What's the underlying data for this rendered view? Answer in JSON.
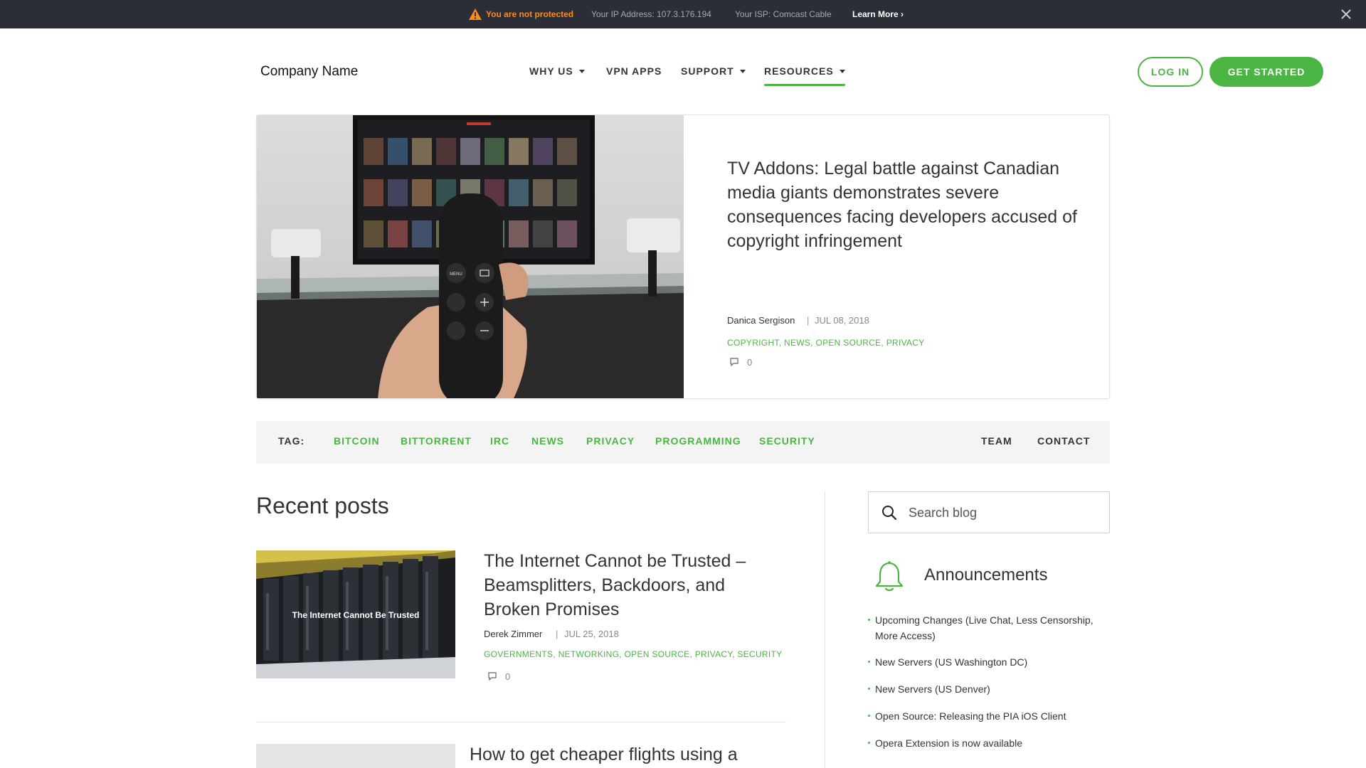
{
  "notice": {
    "warning": "You are not protected",
    "ip": "Your IP Address: 107.3.176.194",
    "isp": "Your ISP: Comcast Cable",
    "learn_more": "Learn More ›"
  },
  "header": {
    "brand": "Company Name",
    "nav": [
      {
        "label": "WHY US",
        "dropdown": true
      },
      {
        "label": "VPN APPS",
        "dropdown": false
      },
      {
        "label": "SUPPORT",
        "dropdown": true
      },
      {
        "label": "RESOURCES",
        "dropdown": true,
        "active": true
      }
    ],
    "login": "LOG IN",
    "get_started": "GET STARTED"
  },
  "featured": {
    "title": "TV Addons: Legal battle against Canadian media giants demonstrates severe consequences facing developers accused of copyright infringement",
    "author": "Danica Sergison",
    "separator": "|",
    "date": "JUL 08, 2018",
    "categories": "COPYRIGHT, NEWS, OPEN SOURCE, PRIVACY",
    "comments": "0",
    "remote_menu": "MENU"
  },
  "tagbar": {
    "label": "TAG:",
    "tags": [
      "BITCOIN",
      "BITTORRENT",
      "IRC",
      "NEWS",
      "PRIVACY",
      "PROGRAMMING",
      "SECURITY"
    ],
    "team": "TEAM",
    "contact": "CONTACT"
  },
  "recent": {
    "heading": "Recent posts",
    "posts": [
      {
        "image_caption": "The Internet Cannot Be Trusted",
        "title": "The Internet Cannot be Trusted – Beamsplitters, Backdoors, and Broken Promises",
        "author": "Derek Zimmer",
        "separator": "|",
        "date": "JUL 25, 2018",
        "categories": "GOVERNMENTS, NETWORKING, OPEN SOURCE, PRIVACY, SECURITY",
        "comments": "0"
      },
      {
        "title": "How to get cheaper flights using a VPN"
      }
    ]
  },
  "sidebar": {
    "search_placeholder": "Search blog",
    "announcements_title": "Announcements",
    "announcements": [
      "Upcoming Changes (Live Chat, Less Censorship, More Access)",
      "New Servers (US Washington DC)",
      "New Servers (US Denver)",
      "Open Source: Releasing the PIA iOS Client",
      "Opera Extension is now available"
    ]
  },
  "colors": {
    "accent": "#4bb543",
    "notice_bg": "#2b2e37",
    "warning": "#ff8a1a"
  }
}
